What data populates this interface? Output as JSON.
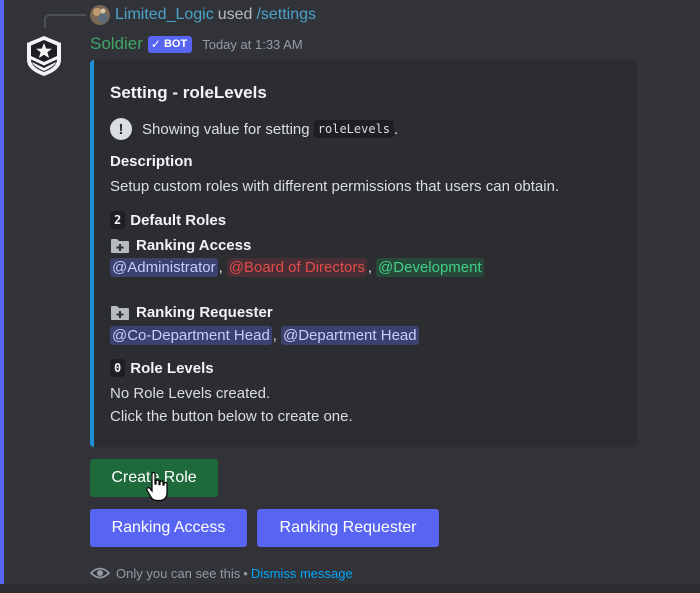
{
  "reply": {
    "username": "Limited_Logic",
    "used_text": "used",
    "command": "/settings"
  },
  "message": {
    "author": "Soldier",
    "bot_tag": "BOT",
    "timestamp": "Today at 1:33 AM"
  },
  "embed": {
    "accent_color": "#1e8fd0",
    "title": "Setting - roleLevels",
    "info_prefix": "Showing value for setting",
    "setting_code": "roleLevels",
    "info_suffix": ".",
    "description_heading": "Description",
    "description_text": "Setup custom roles with different permissions that users can obtain.",
    "default_roles_count": "2",
    "default_roles_heading": "Default Roles",
    "groups": [
      {
        "title": "Ranking Access",
        "mentions": [
          "@Administrator",
          "@Board of Directors",
          "@Development"
        ]
      },
      {
        "title": "Ranking Requester",
        "mentions": [
          "@Co-Department Head",
          "@Department Head"
        ]
      }
    ],
    "separator": ",",
    "role_levels_count": "0",
    "role_levels_heading": "Role Levels",
    "role_levels_line1": "No Role Levels created.",
    "role_levels_line2": "Click the button below to create one."
  },
  "buttons": {
    "create_role": "Create Role",
    "ranking_access": "Ranking Access",
    "ranking_requester": "Ranking Requester"
  },
  "footer": {
    "ephemeral_text": "Only you can see this",
    "bullet": "•",
    "dismiss_link": "Dismiss message"
  },
  "icons": {
    "reply_avatar": "user-avatar-icon",
    "bot_avatar": "military-badge-icon",
    "info": "exclamation-circle-icon",
    "folder": "folder-plus-icon",
    "eye": "eye-icon",
    "cursor": "hand-pointer-icon"
  },
  "colors": {
    "background": "#323339",
    "embed_bg": "#2b2d31",
    "author": "#3fa567",
    "link": "#4aa3c8",
    "blurple": "#5865f2",
    "success": "#1f6a3a",
    "mention_red": "#e04b4b",
    "mention_green": "#43cf86"
  }
}
